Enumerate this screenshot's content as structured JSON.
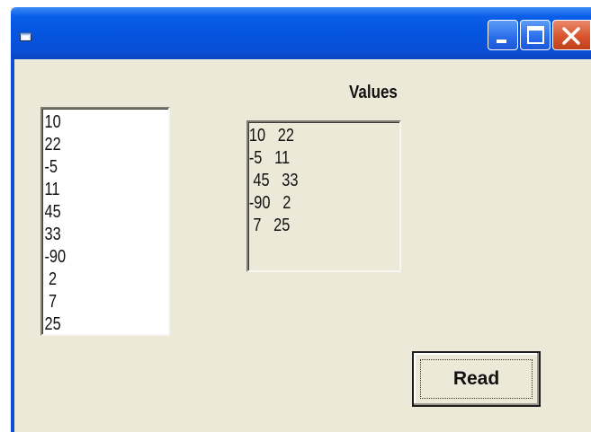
{
  "window": {
    "accent": "#0a5ee8",
    "close_color": "#d8542c",
    "icons": [
      "app-icon",
      "minimize-icon",
      "maximize-icon",
      "close-icon"
    ]
  },
  "values_label": "Values",
  "list": {
    "items": [
      "10",
      "22",
      "-5",
      "11",
      "45",
      "33",
      "-90",
      " 2",
      " 7",
      "25"
    ]
  },
  "grid": {
    "rows": [
      "10   22",
      "-5   11",
      " 45   33",
      "-90   2",
      " 7   25"
    ]
  },
  "read_button": {
    "label": "Read"
  }
}
